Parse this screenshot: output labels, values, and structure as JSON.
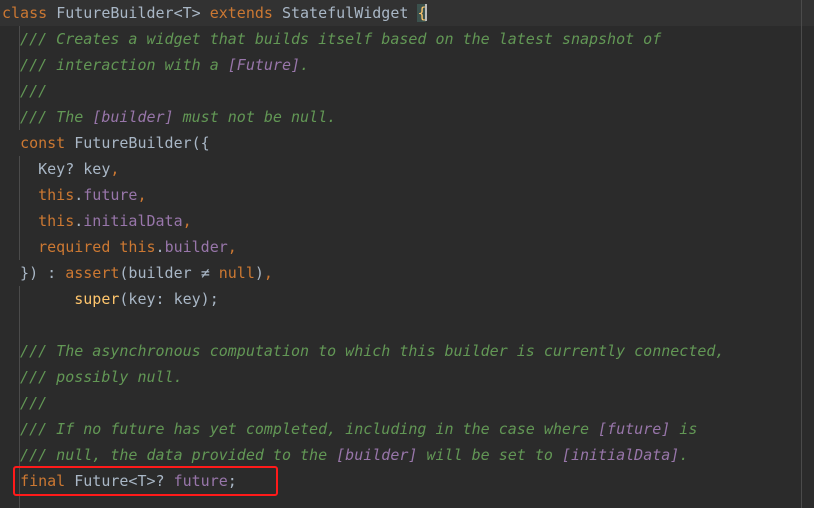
{
  "editor": {
    "language": "dart",
    "theme": "darcula",
    "background_color": "#2b2b2b",
    "current_line_color": "#323232",
    "ruler_color": "#4b4b4b",
    "colors": {
      "keyword": "#cc7832",
      "identifier": "#a9b7c6",
      "field": "#9876aa",
      "comment": "#629755",
      "doc_reference": "#9876aa",
      "function": "#ffc66d",
      "brace_match_bg": "#3b514d",
      "annotation_red": "#ff1a1a",
      "caret": "#bbbbbb"
    }
  },
  "annotation": {
    "type": "rectangle",
    "color": "#ff1a1a",
    "target_text": "final Future<T>? future;"
  },
  "lines": [
    {
      "id": "line-1",
      "current": true,
      "tokens": [
        {
          "t": "class",
          "c": "kw"
        },
        {
          "t": " ",
          "c": "id"
        },
        {
          "t": "FutureBuilder<T>",
          "c": "id"
        },
        {
          "t": " ",
          "c": "id"
        },
        {
          "t": "extends",
          "c": "kw"
        },
        {
          "t": " ",
          "c": "id"
        },
        {
          "t": "StatefulWidget",
          "c": "id"
        },
        {
          "t": " ",
          "c": "id"
        },
        {
          "t": "{",
          "c": "brace-match"
        }
      ]
    },
    {
      "id": "line-2",
      "tokens": [
        {
          "t": "  /// Creates a widget that builds itself based on the latest snapshot of",
          "c": "cmt"
        }
      ]
    },
    {
      "id": "line-3",
      "tokens": [
        {
          "t": "  /// interaction with a ",
          "c": "cmt"
        },
        {
          "t": "[Future]",
          "c": "ref"
        },
        {
          "t": ".",
          "c": "cmt"
        }
      ]
    },
    {
      "id": "line-4",
      "tokens": [
        {
          "t": "  ///",
          "c": "cmt"
        }
      ]
    },
    {
      "id": "line-5",
      "tokens": [
        {
          "t": "  /// The ",
          "c": "cmt"
        },
        {
          "t": "[builder]",
          "c": "ref"
        },
        {
          "t": " must not be null.",
          "c": "cmt"
        }
      ]
    },
    {
      "id": "line-6",
      "tokens": [
        {
          "t": "  ",
          "c": "id"
        },
        {
          "t": "const",
          "c": "kw"
        },
        {
          "t": " ",
          "c": "id"
        },
        {
          "t": "FutureBuilder",
          "c": "id"
        },
        {
          "t": "({",
          "c": "id"
        }
      ]
    },
    {
      "id": "line-7",
      "tokens": [
        {
          "t": "    ",
          "c": "id"
        },
        {
          "t": "Key? key",
          "c": "id"
        },
        {
          "t": ",",
          "c": "kw"
        }
      ]
    },
    {
      "id": "line-8",
      "tokens": [
        {
          "t": "    ",
          "c": "id"
        },
        {
          "t": "this",
          "c": "kw"
        },
        {
          "t": ".",
          "c": "id"
        },
        {
          "t": "future",
          "c": "fld"
        },
        {
          "t": ",",
          "c": "kw"
        }
      ]
    },
    {
      "id": "line-9",
      "tokens": [
        {
          "t": "    ",
          "c": "id"
        },
        {
          "t": "this",
          "c": "kw"
        },
        {
          "t": ".",
          "c": "id"
        },
        {
          "t": "initialData",
          "c": "fld"
        },
        {
          "t": ",",
          "c": "kw"
        }
      ]
    },
    {
      "id": "line-10",
      "tokens": [
        {
          "t": "    ",
          "c": "id"
        },
        {
          "t": "required",
          "c": "kw"
        },
        {
          "t": " ",
          "c": "id"
        },
        {
          "t": "this",
          "c": "kw"
        },
        {
          "t": ".",
          "c": "id"
        },
        {
          "t": "builder",
          "c": "fld"
        },
        {
          "t": ",",
          "c": "kw"
        }
      ]
    },
    {
      "id": "line-11",
      "tokens": [
        {
          "t": "  }) : ",
          "c": "id"
        },
        {
          "t": "assert",
          "c": "kw"
        },
        {
          "t": "(builder ",
          "c": "id"
        },
        {
          "t": "≠",
          "c": "id"
        },
        {
          "t": " ",
          "c": "id"
        },
        {
          "t": "null",
          "c": "kw"
        },
        {
          "t": ")",
          "c": "id"
        },
        {
          "t": ",",
          "c": "kw"
        }
      ]
    },
    {
      "id": "line-12",
      "tokens": [
        {
          "t": "        ",
          "c": "id"
        },
        {
          "t": "super",
          "c": "fn"
        },
        {
          "t": "(key: key);",
          "c": "id"
        }
      ]
    },
    {
      "id": "line-13",
      "tokens": [
        {
          "t": "",
          "c": "id"
        }
      ]
    },
    {
      "id": "line-14",
      "tokens": [
        {
          "t": "  /// The asynchronous computation to which this builder is currently connected,",
          "c": "cmt"
        }
      ]
    },
    {
      "id": "line-15",
      "tokens": [
        {
          "t": "  /// possibly null.",
          "c": "cmt"
        }
      ]
    },
    {
      "id": "line-16",
      "tokens": [
        {
          "t": "  ///",
          "c": "cmt"
        }
      ]
    },
    {
      "id": "line-17",
      "tokens": [
        {
          "t": "  /// If no future has yet completed, including in the case where ",
          "c": "cmt"
        },
        {
          "t": "[future]",
          "c": "ref"
        },
        {
          "t": " is",
          "c": "cmt"
        }
      ]
    },
    {
      "id": "line-18",
      "tokens": [
        {
          "t": "  /// null, the data provided to the ",
          "c": "cmt"
        },
        {
          "t": "[builder]",
          "c": "ref"
        },
        {
          "t": " will be set to ",
          "c": "cmt"
        },
        {
          "t": "[initialData]",
          "c": "ref"
        },
        {
          "t": ".",
          "c": "cmt"
        }
      ]
    },
    {
      "id": "line-19",
      "annotated": true,
      "tokens": [
        {
          "t": "  ",
          "c": "id"
        },
        {
          "t": "final",
          "c": "kw"
        },
        {
          "t": " ",
          "c": "id"
        },
        {
          "t": "Future<T>?",
          "c": "id"
        },
        {
          "t": " ",
          "c": "id"
        },
        {
          "t": "future",
          "c": "fld"
        },
        {
          "t": ";",
          "c": "id"
        }
      ]
    }
  ]
}
